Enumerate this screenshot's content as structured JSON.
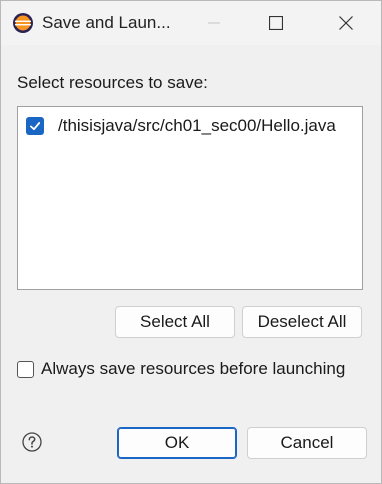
{
  "window": {
    "title": "Save and Laun..."
  },
  "dialog": {
    "prompt": "Select resources to save:",
    "resources": [
      {
        "path": "/thisisjava/src/ch01_sec00/Hello.java",
        "checked": true
      }
    ],
    "select_all_label": "Select All",
    "deselect_all_label": "Deselect All",
    "always_save_label": "Always save resources before launching",
    "always_save_checked": false,
    "ok_label": "OK",
    "cancel_label": "Cancel"
  },
  "icons": {
    "app": "eclipse-icon",
    "minimize": "minimize-icon",
    "maximize": "maximize-icon",
    "close": "close-icon",
    "help": "help-icon",
    "check": "checkmark-icon"
  },
  "colors": {
    "accent": "#1a66c4",
    "background": "#f0f0f0"
  }
}
